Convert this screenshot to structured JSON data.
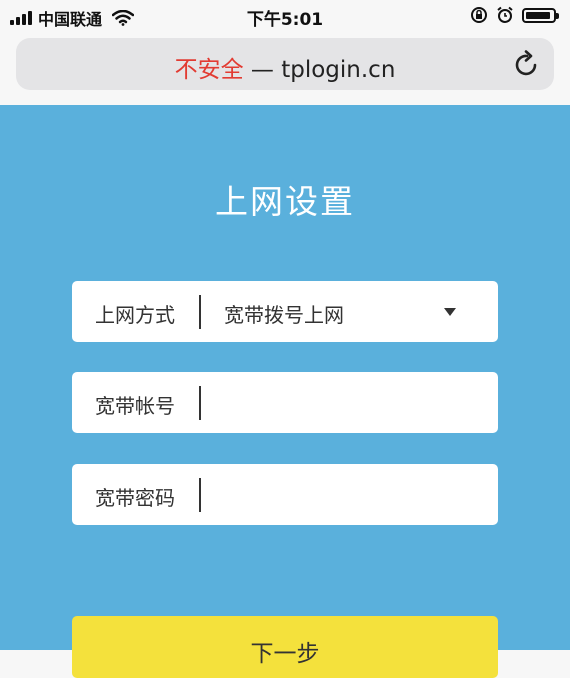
{
  "status_bar": {
    "carrier": "中国联通",
    "time": "下午5:01"
  },
  "browser": {
    "security_warning": "不安全",
    "separator": "—",
    "domain": "tplogin.cn"
  },
  "page": {
    "title": "上网设置",
    "fields": {
      "mode": {
        "label": "上网方式",
        "value": "宽带拨号上网"
      },
      "account": {
        "label": "宽带帐号",
        "value": ""
      },
      "password": {
        "label": "宽带密码",
        "value": ""
      }
    },
    "next_button": "下一步"
  },
  "colors": {
    "background": "#5ab0dc",
    "button": "#f4e13c",
    "warning": "#e23b32"
  }
}
